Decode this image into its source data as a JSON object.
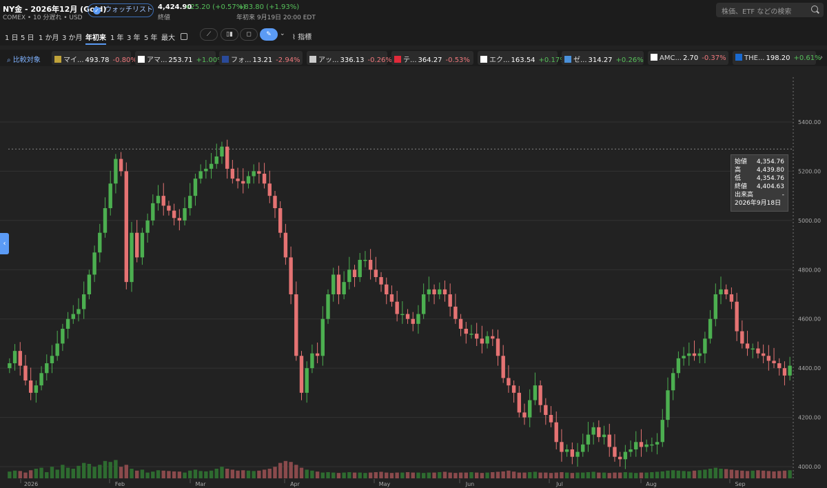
{
  "header": {
    "title": "NY金 - 2026年12月 (Gold)",
    "subtitle": "COMEX • 10 分遅れ • USD",
    "watchlist_label": "ウォッチリスト",
    "price": "4,424.90",
    "change": "+25.20 (+0.57%)",
    "ytd_change": "+83.80 (+1.93%)",
    "close_label": "終値",
    "ytd_label": "年初来 9月19日 20:00 EDT",
    "search_placeholder": "株価、ETF などの検索"
  },
  "ranges": [
    "1 日",
    "5 日",
    "1 か月",
    "3 か月",
    "年初来",
    "1 年",
    "3 年",
    "5 年",
    "最大"
  ],
  "active_range": "年初来",
  "toolbar": {
    "indicator_label": "指標"
  },
  "compare": {
    "label": "比較対象",
    "chips": [
      {
        "name": "マイ...",
        "price": "493.78",
        "change": "-0.80%",
        "dir": "down",
        "color": "#c0a33a"
      },
      {
        "name": "アマ...",
        "price": "253.71",
        "change": "+1.00%",
        "dir": "up",
        "color": "#ffffff"
      },
      {
        "name": "フォ...",
        "price": "13.21",
        "change": "-2.94%",
        "dir": "down",
        "color": "#2a4a9a"
      },
      {
        "name": "アッ...",
        "price": "336.13",
        "change": "-0.26%",
        "dir": "down",
        "color": "#cccccc"
      },
      {
        "name": "テ...",
        "price": "364.27",
        "change": "-0.53%",
        "dir": "down",
        "color": "#e02a3a"
      },
      {
        "name": "エク...",
        "price": "163.54",
        "change": "+0.17%",
        "dir": "up",
        "color": "#ffffff"
      },
      {
        "name": "ゼ...",
        "price": "314.27",
        "change": "+0.26%",
        "dir": "up",
        "color": "#4a90d9"
      },
      {
        "name": "AMC...",
        "price": "2.70",
        "change": "-0.37%",
        "dir": "down",
        "color": "#ffffff"
      },
      {
        "name": "THE...",
        "price": "198.20",
        "change": "+0.61%",
        "dir": "up",
        "color": "#1a6ad0"
      }
    ]
  },
  "tooltip": {
    "rows": [
      {
        "label": "始値",
        "value": "4,354.76"
      },
      {
        "label": "高",
        "value": "4,439.80"
      },
      {
        "label": "低",
        "value": "4,354.76"
      },
      {
        "label": "終値",
        "value": "4,404.63"
      },
      {
        "label": "出来高",
        "value": "-"
      }
    ],
    "date": "2026年9月18日"
  },
  "colors": {
    "up": "#4caf50",
    "down": "#e57373",
    "accent": "#5b9bf5"
  },
  "chart_data": {
    "type": "candlestick",
    "y_ticks": [
      "5400.00",
      "5200.00",
      "5000.00",
      "4800.00",
      "4600.00",
      "4400.00",
      "4200.00",
      "4000.00"
    ],
    "ylim": [
      4000,
      5400
    ],
    "x_ticks": [
      "2026",
      "Feb",
      "Mar",
      "Apr",
      "May",
      "Jun",
      "Jul",
      "Aug",
      "Sep"
    ],
    "guide_value": 5290,
    "closes": [
      4420,
      4470,
      4410,
      4350,
      4300,
      4330,
      4380,
      4420,
      4450,
      4500,
      4560,
      4600,
      4620,
      4640,
      4700,
      4780,
      4870,
      4950,
      5050,
      5150,
      5250,
      5200,
      4750,
      4950,
      4850,
      4950,
      5000,
      5070,
      5100,
      5060,
      5040,
      5010,
      5000,
      5050,
      5100,
      5170,
      5200,
      5210,
      5230,
      5260,
      5300,
      5210,
      5170,
      5160,
      5150,
      5180,
      5200,
      5190,
      5150,
      5100,
      5050,
      4950,
      4850,
      4700,
      4450,
      4300,
      4400,
      4460,
      4450,
      4600,
      4700,
      4780,
      4700,
      4750,
      4800,
      4770,
      4840,
      4840,
      4800,
      4770,
      4740,
      4700,
      4670,
      4620,
      4620,
      4600,
      4580,
      4620,
      4700,
      4720,
      4700,
      4720,
      4700,
      4650,
      4600,
      4560,
      4540,
      4540,
      4520,
      4500,
      4530,
      4520,
      4450,
      4360,
      4330,
      4300,
      4220,
      4200,
      4270,
      4330,
      4250,
      4210,
      4180,
      4100,
      4060,
      4070,
      4040,
      4060,
      4090,
      4130,
      4160,
      4120,
      4130,
      4080,
      4040,
      4030,
      4060,
      4070,
      4100,
      4080,
      4090,
      4090,
      4100,
      4190,
      4310,
      4380,
      4440,
      4450,
      4460,
      4450,
      4460,
      4520,
      4600,
      4700,
      4720,
      4700,
      4670,
      4550,
      4500,
      4480,
      4480,
      4460,
      4450,
      4430,
      4420,
      4400,
      4370,
      4410
    ],
    "volumes": [
      0.35,
      0.4,
      0.38,
      0.3,
      0.42,
      0.5,
      0.55,
      0.32,
      0.6,
      0.45,
      0.7,
      0.55,
      0.5,
      0.65,
      0.8,
      0.75,
      0.6,
      0.7,
      0.9,
      0.85,
      0.95,
      0.6,
      0.7,
      0.5,
      0.4,
      0.45,
      0.3,
      0.35,
      0.42,
      0.4,
      0.38,
      0.36,
      0.35,
      0.3,
      0.4,
      0.45,
      0.38,
      0.36,
      0.4,
      0.5,
      0.6,
      0.5,
      0.45,
      0.4,
      0.42,
      0.4,
      0.38,
      0.4,
      0.45,
      0.5,
      0.6,
      0.8,
      0.9,
      0.85,
      0.7,
      0.55,
      0.45,
      0.4,
      0.35,
      0.3,
      0.32,
      0.3,
      0.28,
      0.3,
      0.32,
      0.3,
      0.3,
      0.28,
      0.3,
      0.32,
      0.34,
      0.3,
      0.28,
      0.3,
      0.3,
      0.32,
      0.3,
      0.3,
      0.28,
      0.3,
      0.3,
      0.32,
      0.34,
      0.3,
      0.28,
      0.3,
      0.3,
      0.32,
      0.3,
      0.28,
      0.3,
      0.32,
      0.34,
      0.36,
      0.4,
      0.35,
      0.3,
      0.3,
      0.32,
      0.34,
      0.3,
      0.3,
      0.28,
      0.3,
      0.32,
      0.3,
      0.28,
      0.3,
      0.3,
      0.32,
      0.34,
      0.3,
      0.3,
      0.28,
      0.3,
      0.3,
      0.32,
      0.3,
      0.28,
      0.3,
      0.3,
      0.32,
      0.34,
      0.36,
      0.4,
      0.42,
      0.4,
      0.38,
      0.36,
      0.4,
      0.42,
      0.45,
      0.5,
      0.55,
      0.5,
      0.48,
      0.45,
      0.42,
      0.4,
      0.38,
      0.4,
      0.42,
      0.4,
      0.38,
      0.36,
      0.38,
      0.4,
      0.42
    ]
  }
}
